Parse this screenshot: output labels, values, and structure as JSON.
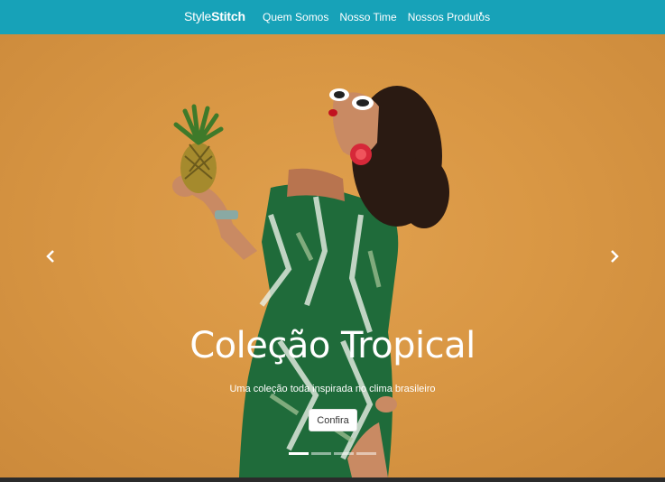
{
  "navbar": {
    "brand_light": "Style",
    "brand_bold": "Stitch",
    "links": [
      "Quem Somos",
      "Nosso Time",
      "Nossos Produtos"
    ],
    "caret": "▼",
    "color": "#17a2b8"
  },
  "carousel": {
    "title": "Coleção Tropical",
    "subtitle": "Uma coleção toda inspirada no clima brasileiro",
    "cta_label": "Confira",
    "slide_count": 4,
    "active_slide": 1,
    "background_color": "#d99744",
    "icons": {
      "prev": "chevron-left-icon",
      "next": "chevron-right-icon"
    }
  }
}
